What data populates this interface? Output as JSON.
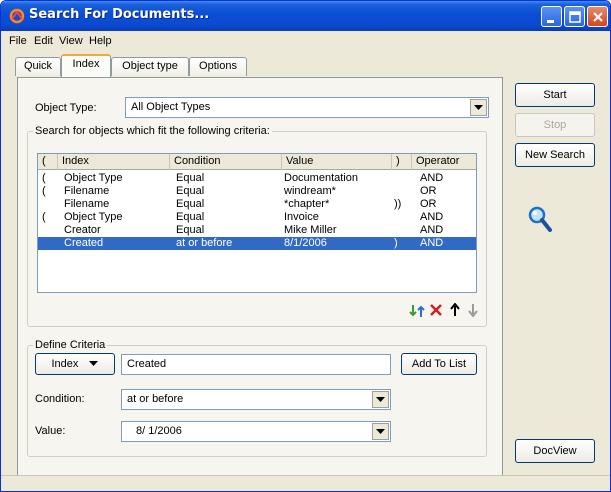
{
  "window": {
    "title": "Search For Documents...",
    "colors": {
      "title_blue": "#0a4ed6",
      "selection": "#316ac5",
      "face": "#ece9d8"
    }
  },
  "menu": [
    "File",
    "Edit",
    "View",
    "Help"
  ],
  "tabs": [
    {
      "label": "Quick",
      "active": false
    },
    {
      "label": "Index",
      "active": true
    },
    {
      "label": "Object type",
      "active": false
    },
    {
      "label": "Options",
      "active": false
    }
  ],
  "object_type": {
    "label": "Object Type:",
    "value": "All Object Types"
  },
  "criteria": {
    "group_title": "Search for objects which fit the following criteria:",
    "columns": [
      "(",
      "Index",
      "Condition",
      "Value",
      ")",
      "Operator"
    ],
    "rows": [
      {
        "open": "(",
        "index": "Object Type",
        "condition": "Equal",
        "value": "Documentation",
        "close": "",
        "operator": "AND"
      },
      {
        "open": "(",
        "index": "Filename",
        "condition": "Equal",
        "value": "windream*",
        "close": "",
        "operator": "OR"
      },
      {
        "open": "",
        "index": "Filename",
        "condition": "Equal",
        "value": "*chapter*",
        "close": "))",
        "operator": "OR"
      },
      {
        "open": "(",
        "index": "Object Type",
        "condition": "Equal",
        "value": "Invoice",
        "close": "",
        "operator": "AND"
      },
      {
        "open": "",
        "index": "Creator",
        "condition": "Equal",
        "value": "Mike Miller",
        "close": "",
        "operator": "AND"
      },
      {
        "open": "",
        "index": "Created",
        "condition": "at or before",
        "value": "8/1/2006",
        "close": ")",
        "operator": "AND",
        "selected": true
      }
    ],
    "toolbar_icons": [
      "add-criteria-icon",
      "delete-icon",
      "move-up-icon",
      "move-down-icon"
    ]
  },
  "define": {
    "group_title": "Define Criteria",
    "index_button": "Index",
    "index_value": "Created",
    "add_button": "Add To List",
    "condition_label": "Condition:",
    "condition_value": "at or before",
    "value_label": "Value:",
    "value_value": "8/ 1/2006"
  },
  "buttons": {
    "start": "Start",
    "stop": "Stop",
    "new_search": "New Search",
    "docview": "DocView"
  }
}
